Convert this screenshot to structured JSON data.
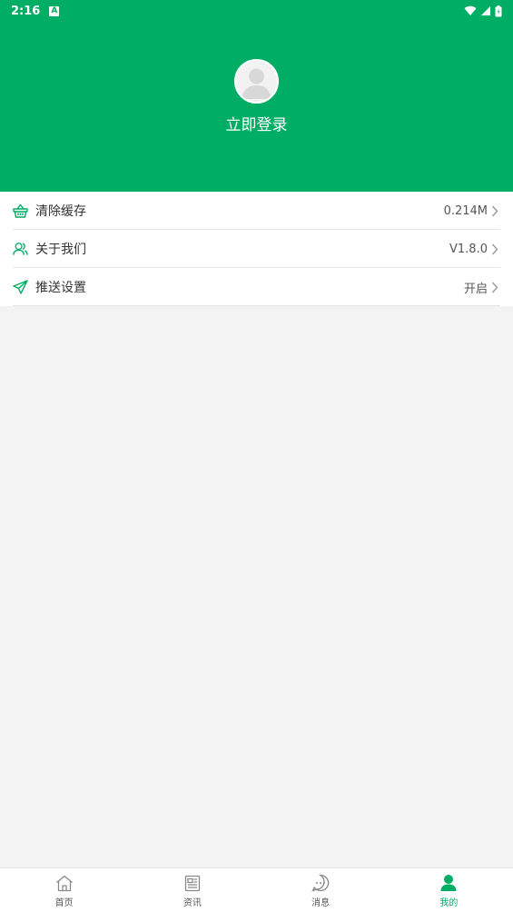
{
  "status_bar": {
    "time": "2:16",
    "notification_letter": "A"
  },
  "profile": {
    "login_label": "立即登录"
  },
  "menu": [
    {
      "label": "清除缓存",
      "value": "0.214M",
      "icon": "basket-icon"
    },
    {
      "label": "关于我们",
      "value": "V1.8.0",
      "icon": "users-icon"
    },
    {
      "label": "推送设置",
      "value": "开启",
      "icon": "send-icon"
    }
  ],
  "tabs": [
    {
      "label": "首页",
      "icon": "home-icon",
      "active": false
    },
    {
      "label": "资讯",
      "icon": "news-icon",
      "active": false
    },
    {
      "label": "消息",
      "icon": "message-icon",
      "active": false
    },
    {
      "label": "我的",
      "icon": "user-icon",
      "active": true
    }
  ],
  "colors": {
    "brand": "#00ad65",
    "background": "#f3f3f3"
  }
}
